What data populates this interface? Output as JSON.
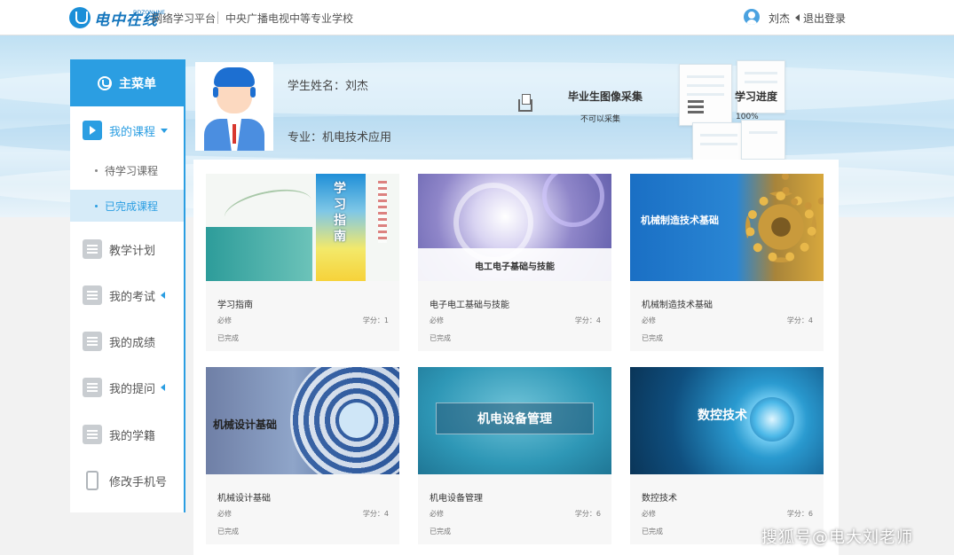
{
  "header": {
    "logo_text": "电中在线",
    "logo_sub": "DDZONLINE",
    "platform": "网络学习平台",
    "school": "中央广播电视中等专业学校",
    "user_name": "刘杰",
    "logout": "退出登录"
  },
  "sidebar": {
    "main_menu": "主菜单",
    "items": {
      "my_courses": "我的课程",
      "pending_courses": "待学习课程",
      "completed_courses": "已完成课程",
      "teaching_plan": "教学计划",
      "my_exams": "我的考试",
      "my_grades": "我的成绩",
      "my_questions": "我的提问",
      "my_status": "我的学籍",
      "change_phone": "修改手机号"
    }
  },
  "profile": {
    "name_label": "学生姓名：刘杰",
    "major_label": "专业：机电技术应用",
    "collect_title": "毕业生图像采集",
    "collect_status": "不可以采集",
    "progress_title": "学习进度",
    "progress_value": "100%"
  },
  "courses": [
    {
      "name": "学习指南",
      "type": "必修",
      "credit": "学分：1",
      "status": "已完成",
      "thumb_title": "学习指南"
    },
    {
      "name": "电子电工基础与技能",
      "type": "必修",
      "credit": "学分：4",
      "status": "已完成",
      "thumb_title": "电工电子基础与技能"
    },
    {
      "name": "机械制造技术基础",
      "type": "必修",
      "credit": "学分：4",
      "status": "已完成",
      "thumb_title": "机械制造技术基础"
    },
    {
      "name": "机械设计基础",
      "type": "必修",
      "credit": "学分：4",
      "status": "已完成",
      "thumb_title": "机械设计基础"
    },
    {
      "name": "机电设备管理",
      "type": "必修",
      "credit": "学分：6",
      "status": "已完成",
      "thumb_title": "机电设备管理"
    },
    {
      "name": "数控技术",
      "type": "必修",
      "credit": "学分：6",
      "status": "已完成",
      "thumb_title": "数控技术"
    }
  ],
  "watermark": "搜狐号@电大刘老师",
  "colors": {
    "accent": "#2b9ee2",
    "sidebar_active_bg": "#d6ebf8"
  }
}
